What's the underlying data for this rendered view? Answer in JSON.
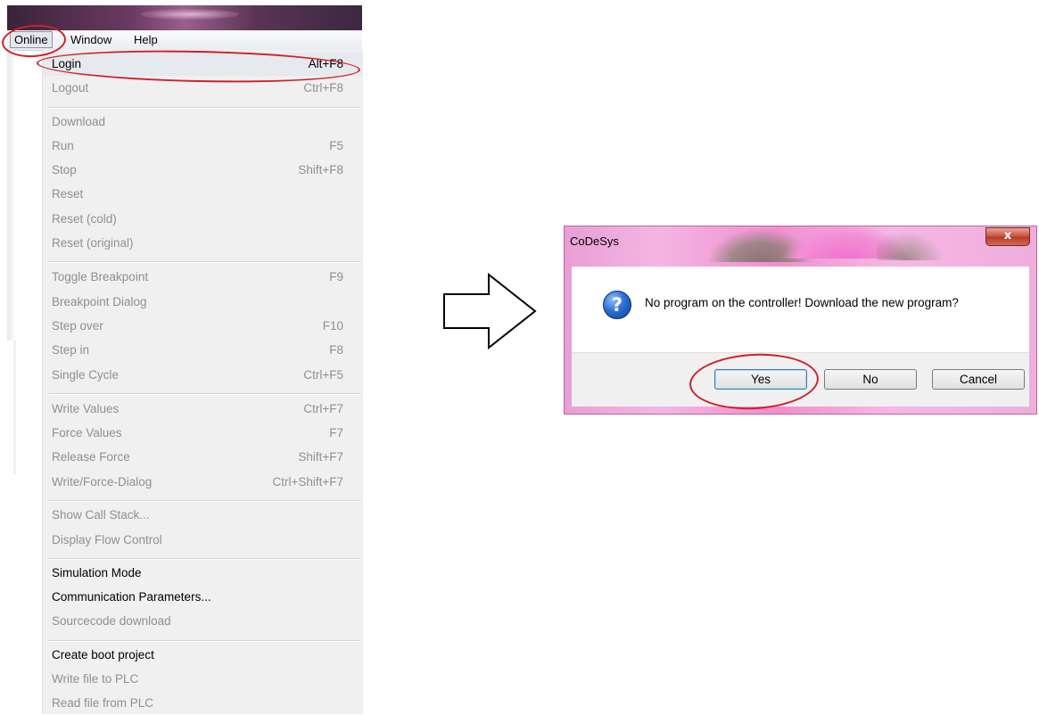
{
  "menubar": {
    "items": [
      "Online",
      "Window",
      "Help"
    ]
  },
  "online_menu": {
    "items": [
      {
        "label": "Login",
        "shortcut": "Alt+F8"
      },
      {
        "label": "Logout",
        "shortcut": "Ctrl+F8"
      },
      {
        "label": "Download",
        "shortcut": ""
      },
      {
        "label": "Run",
        "shortcut": "F5"
      },
      {
        "label": "Stop",
        "shortcut": "Shift+F8"
      },
      {
        "label": "Reset",
        "shortcut": ""
      },
      {
        "label": "Reset (cold)",
        "shortcut": ""
      },
      {
        "label": "Reset (original)",
        "shortcut": ""
      },
      {
        "label": "Toggle Breakpoint",
        "shortcut": "F9"
      },
      {
        "label": "Breakpoint Dialog",
        "shortcut": ""
      },
      {
        "label": "Step over",
        "shortcut": "F10"
      },
      {
        "label": "Step in",
        "shortcut": "F8"
      },
      {
        "label": "Single Cycle",
        "shortcut": "Ctrl+F5"
      },
      {
        "label": "Write Values",
        "shortcut": "Ctrl+F7"
      },
      {
        "label": "Force Values",
        "shortcut": "F7"
      },
      {
        "label": "Release Force",
        "shortcut": "Shift+F7"
      },
      {
        "label": "Write/Force-Dialog",
        "shortcut": "Ctrl+Shift+F7"
      },
      {
        "label": "Show Call Stack...",
        "shortcut": ""
      },
      {
        "label": "Display Flow Control",
        "shortcut": ""
      },
      {
        "label": "Simulation Mode",
        "shortcut": ""
      },
      {
        "label": "Communication Parameters...",
        "shortcut": ""
      },
      {
        "label": "Sourcecode download",
        "shortcut": ""
      },
      {
        "label": "Create boot project",
        "shortcut": ""
      },
      {
        "label": "Write file to PLC",
        "shortcut": ""
      },
      {
        "label": "Read file from PLC",
        "shortcut": ""
      }
    ]
  },
  "dialog": {
    "title": "CoDeSys",
    "close_glyph": "x",
    "icon": "question-icon",
    "icon_glyph": "?",
    "message": "No program on the controller! Download the new program?",
    "buttons": {
      "yes": "Yes",
      "no": "No",
      "cancel": "Cancel"
    }
  },
  "colors": {
    "highlight_oval": "#d02028",
    "dialog_frame": "#f08fd0",
    "menu_background": "#f0f0f0",
    "disabled_text": "#8f8f8f"
  }
}
